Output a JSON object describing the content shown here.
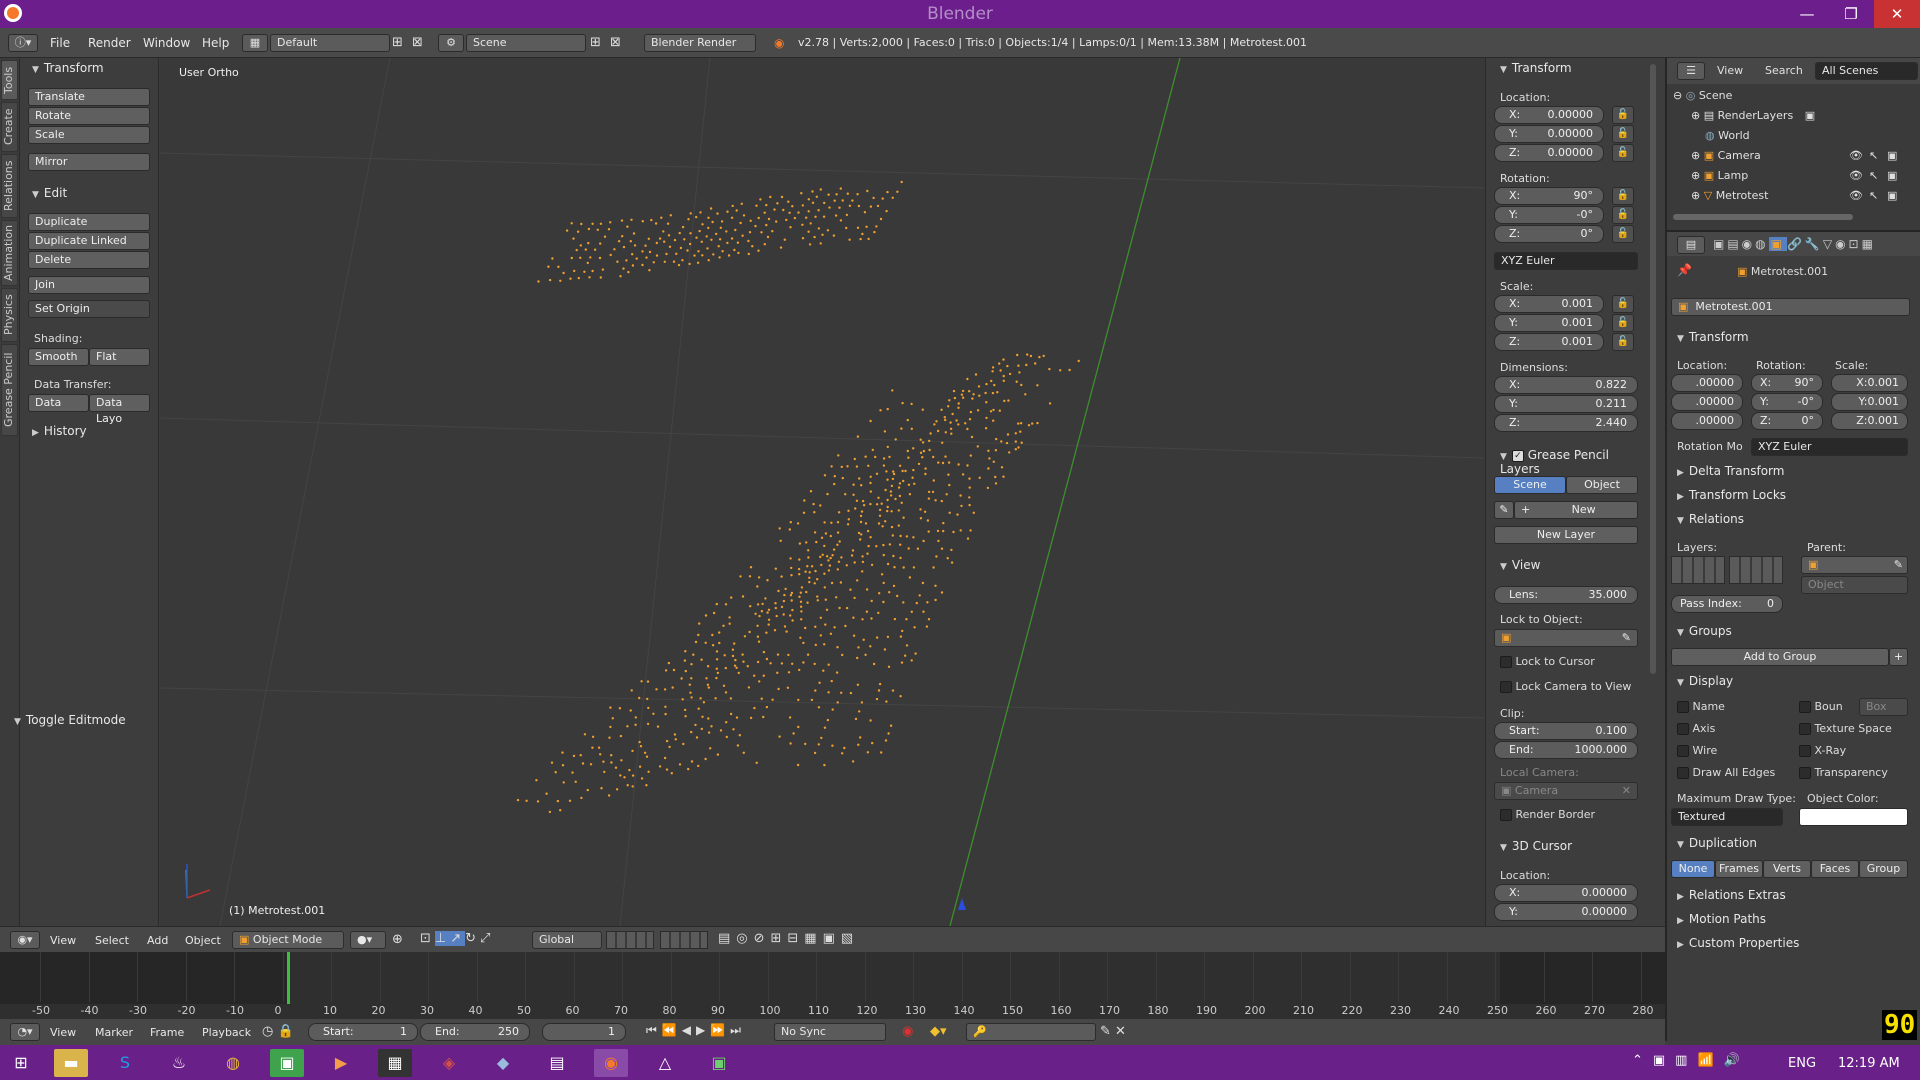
{
  "window": {
    "title": "Blender"
  },
  "menubar": {
    "menus": [
      "File",
      "Render",
      "Window",
      "Help"
    ],
    "layout": "Default",
    "scene": "Scene",
    "engine": "Blender Render",
    "stats": "v2.78 | Verts:2,000 | Faces:0 | Tris:0 | Objects:1/4 | Lamps:0/1 | Mem:13.38M | Metrotest.001"
  },
  "tool_tabs": [
    "Tools",
    "Create",
    "Relations",
    "Animation",
    "Physics",
    "Grease Pencil"
  ],
  "toolshelf": {
    "transform_title": "Transform",
    "transform_buttons": [
      "Translate",
      "Rotate",
      "Scale"
    ],
    "mirror": "Mirror",
    "edit_title": "Edit",
    "edit_buttons": [
      "Duplicate",
      "Duplicate Linked",
      "Delete"
    ],
    "join": "Join",
    "set_origin": "Set Origin",
    "shading_label": "Shading:",
    "smooth": "Smooth",
    "flat": "Flat",
    "data_transfer_label": "Data Transfer:",
    "data": "Data",
    "data_layo": "Data Layo",
    "history": "History",
    "toggle_editmode": "Toggle Editmode"
  },
  "viewport": {
    "view_name": "User Ortho",
    "object_label": "(1) Metrotest.001"
  },
  "npanel": {
    "transform_title": "Transform",
    "location_label": "Location:",
    "location": [
      {
        "k": "X:",
        "v": "0.00000"
      },
      {
        "k": "Y:",
        "v": "0.00000"
      },
      {
        "k": "Z:",
        "v": "0.00000"
      }
    ],
    "rotation_label": "Rotation:",
    "rotation": [
      {
        "k": "X:",
        "v": "90°"
      },
      {
        "k": "Y:",
        "v": "-0°"
      },
      {
        "k": "Z:",
        "v": "0°"
      }
    ],
    "rotation_mode": "XYZ Euler",
    "scale_label": "Scale:",
    "scale": [
      {
        "k": "X:",
        "v": "0.001"
      },
      {
        "k": "Y:",
        "v": "0.001"
      },
      {
        "k": "Z:",
        "v": "0.001"
      }
    ],
    "dimensions_label": "Dimensions:",
    "dimensions": [
      {
        "k": "X:",
        "v": "0.822"
      },
      {
        "k": "Y:",
        "v": "0.211"
      },
      {
        "k": "Z:",
        "v": "2.440"
      }
    ],
    "gp_title": "Grease Pencil Layers",
    "gp_scene": "Scene",
    "gp_object": "Object",
    "gp_new": "New",
    "gp_new_layer": "New Layer",
    "view_title": "View",
    "lens_label": "Lens:",
    "lens_value": "35.000",
    "lock_to_object": "Lock to Object:",
    "lock_to_cursor": "Lock to Cursor",
    "lock_camera": "Lock Camera to View",
    "clip_label": "Clip:",
    "clip_start_label": "Start:",
    "clip_start": "0.100",
    "clip_end_label": "End:",
    "clip_end": "1000.000",
    "local_camera": "Local Camera:",
    "camera": "Camera",
    "render_border": "Render Border",
    "cursor_title": "3D Cursor",
    "cursor_location_label": "Location:",
    "cursor_location": [
      {
        "k": "X:",
        "v": "0.00000"
      },
      {
        "k": "Y:",
        "v": "0.00000"
      }
    ]
  },
  "outliner": {
    "view": "View",
    "search": "Search",
    "filter": "All Scenes",
    "items": [
      "Scene",
      "RenderLayers",
      "World",
      "Camera",
      "Lamp",
      "Metrotest"
    ]
  },
  "properties": {
    "object_breadcrumb": "Metrotest.001",
    "object_name": "Metrotest.001",
    "transform_title": "Transform",
    "location_label": "Location:",
    "rotation_label": "Rotation:",
    "scale_label": "Scale:",
    "loc": [
      ".00000",
      ".00000",
      ".00000"
    ],
    "rot": [
      {
        "k": "X:",
        "v": "90°"
      },
      {
        "k": "Y:",
        "v": "-0°"
      },
      {
        "k": "Z:",
        "v": "0°"
      }
    ],
    "scl": [
      "X:0.001",
      "Y:0.001",
      "Z:0.001"
    ],
    "rotation_mode_label": "Rotation Mo",
    "rotation_mode": "XYZ Euler",
    "delta_transform": "Delta Transform",
    "transform_locks": "Transform Locks",
    "relations": "Relations",
    "layers_label": "Layers:",
    "parent_label": "Parent:",
    "parent_type": "Object",
    "pass_index_label": "Pass Index:",
    "pass_index": "0",
    "groups": "Groups",
    "add_to_group": "Add to Group",
    "display": "Display",
    "display_left": [
      "Name",
      "Axis",
      "Wire",
      "Draw All Edges"
    ],
    "display_right": [
      "Boun",
      "Texture Space",
      "X-Ray",
      "Transparency"
    ],
    "bounds_type": "Box",
    "max_draw_type_label": "Maximum Draw Type:",
    "object_color_label": "Object Color:",
    "max_draw_type": "Textured",
    "duplication": "Duplication",
    "dup_options": [
      "None",
      "Frames",
      "Verts",
      "Faces",
      "Group"
    ],
    "relations_extras": "Relations Extras",
    "motion_paths": "Motion Paths",
    "custom_properties": "Custom Properties",
    "fps": "90"
  },
  "header3d": {
    "menus": [
      "View",
      "Select",
      "Add",
      "Object"
    ],
    "mode": "Object Mode",
    "orientation": "Global"
  },
  "timeline": {
    "ruler": [
      "-50",
      "-40",
      "-30",
      "-20",
      "-10",
      "0",
      "10",
      "20",
      "30",
      "40",
      "50",
      "60",
      "70",
      "80",
      "90",
      "100",
      "110",
      "120",
      "130",
      "140",
      "150",
      "160",
      "170",
      "180",
      "190",
      "200",
      "210",
      "220",
      "230",
      "240",
      "250",
      "260",
      "270",
      "280"
    ],
    "menus": [
      "View",
      "Marker",
      "Frame",
      "Playback"
    ],
    "start_label": "Start:",
    "start": "1",
    "end_label": "End:",
    "end": "250",
    "current": "1",
    "sync": "No Sync"
  },
  "taskbar": {
    "lang": "ENG",
    "time": "12:19 AM"
  },
  "colors": {
    "title_bar": "#6b1e8c",
    "accent": "#5680c2",
    "points": "#f0a030"
  }
}
